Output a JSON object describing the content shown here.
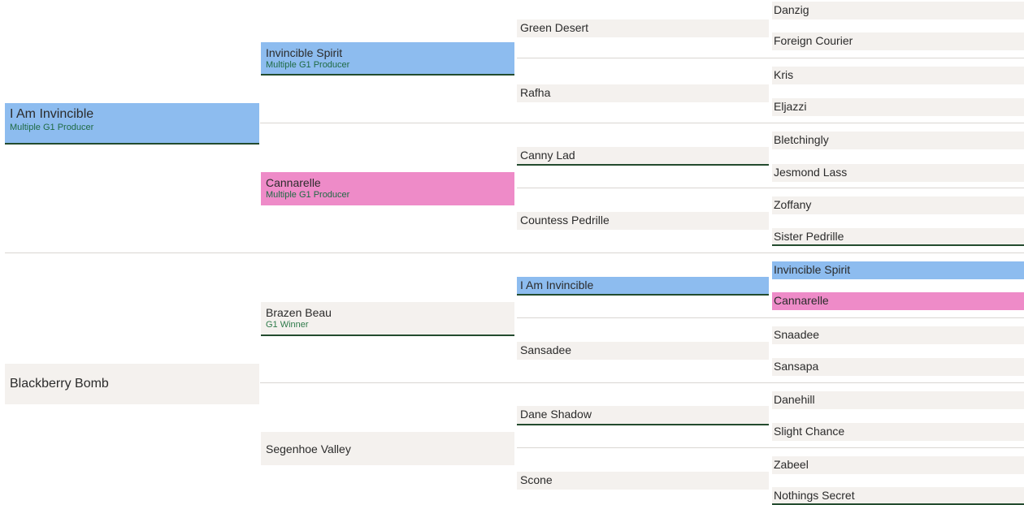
{
  "pedigree": {
    "col0": [
      {
        "name": "I Am Invincible",
        "note": "Multiple G1 Producer"
      },
      {
        "name": "Blackberry Bomb",
        "note": ""
      }
    ],
    "col1": [
      {
        "name": "Invincible Spirit",
        "note": "Multiple G1 Producer"
      },
      {
        "name": "Cannarelle",
        "note": "Multiple G1 Producer"
      },
      {
        "name": "Brazen Beau",
        "note": "G1 Winner"
      },
      {
        "name": "Segenhoe Valley",
        "note": ""
      }
    ],
    "col2": [
      {
        "name": "Green Desert"
      },
      {
        "name": "Rafha"
      },
      {
        "name": "Canny Lad"
      },
      {
        "name": "Countess Pedrille"
      },
      {
        "name": "I Am Invincible"
      },
      {
        "name": "Sansadee"
      },
      {
        "name": "Dane Shadow"
      },
      {
        "name": "Scone"
      }
    ],
    "col3": [
      {
        "name": "Danzig"
      },
      {
        "name": "Foreign Courier"
      },
      {
        "name": "Kris"
      },
      {
        "name": "Eljazzi"
      },
      {
        "name": "Bletchingly"
      },
      {
        "name": "Jesmond Lass"
      },
      {
        "name": "Zoffany"
      },
      {
        "name": "Sister Pedrille"
      },
      {
        "name": "Invincible Spirit"
      },
      {
        "name": "Cannarelle"
      },
      {
        "name": "Snaadee"
      },
      {
        "name": "Sansapa"
      },
      {
        "name": "Danehill"
      },
      {
        "name": "Slight Chance"
      },
      {
        "name": "Zabeel"
      },
      {
        "name": "Nothings Secret"
      }
    ]
  },
  "colors": {
    "sire_highlight": "#8dbcef",
    "dam_highlight": "#ee8bc8",
    "cell_background": "#f4f1ee",
    "underline": "#234b2e",
    "note_text": "#2e7a4a"
  }
}
